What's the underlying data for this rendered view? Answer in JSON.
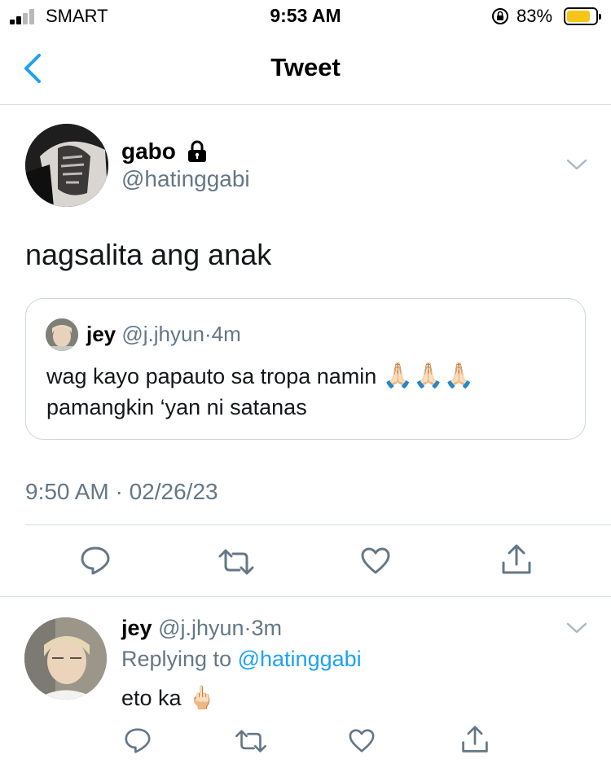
{
  "status_bar": {
    "carrier": "SMART",
    "time": "9:53 AM",
    "battery_pct": "83%",
    "battery_level": 0.83
  },
  "nav": {
    "title": "Tweet",
    "back_icon": "chevron-left-icon"
  },
  "tweet": {
    "author_name": "gabo",
    "lock_icon": "lock-icon",
    "author_handle": "@hatinggabi",
    "text": "nagsalita ang anak",
    "quoted": {
      "name": "jey",
      "handle": "@j.jhyun",
      "separator": "·",
      "age": "4m",
      "line1": "wag kayo papauto sa tropa namin",
      "line1_emojis": "🙏🏻🙏🏻🙏🏻",
      "line2": "pamangkin ‘yan ni satanas"
    },
    "timestamp": "9:50 AM · 02/26/23",
    "actions": [
      "reply-icon",
      "retweet-icon",
      "like-icon",
      "share-icon"
    ]
  },
  "reply": {
    "name": "jey",
    "handle": "@j.jhyun",
    "separator": "·",
    "age": "3m",
    "replying_prefix": "Replying to",
    "replying_to": "@hatinggabi",
    "text": "eto ka",
    "emoji": "🖕🏻"
  },
  "colors": {
    "link": "#1da1f2",
    "secondary_text": "#657786",
    "divider": "#d8dde1",
    "battery": "#f5c518"
  }
}
